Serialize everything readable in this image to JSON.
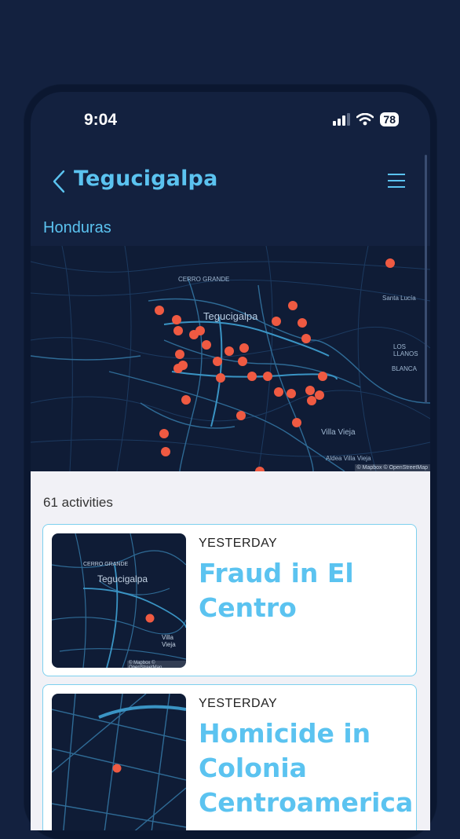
{
  "status_bar": {
    "time": "9:04",
    "battery": "78"
  },
  "header": {
    "title": "Tegucigalpa",
    "subtitle": "Honduras"
  },
  "map": {
    "labels": {
      "city": "Tegucigalpa",
      "cerro_grande": "CERRO GRANDE",
      "villa_vieja": "Villa Vieja",
      "aldea_villa_vieja": "Aldea Villa Vieja",
      "santa_lucia": "Santa Lucía",
      "los_llanos": "LOS LLANOS",
      "blanca": "BLANCA"
    },
    "attribution": "© Mapbox © OpenStreetMap"
  },
  "activities": {
    "count_label": "61 activities",
    "items": [
      {
        "when": "YESTERDAY",
        "title": "Fraud in El Centro",
        "thumb_city": "Tegucigalpa",
        "thumb_area": "CERRO GRANDE",
        "thumb_villa": "Villa Vieja",
        "thumb_attrib": "© Mapbox © OpenStreetMap"
      },
      {
        "when": "YESTERDAY",
        "title": "Homicide in Colonia Centroamerica"
      }
    ]
  },
  "colors": {
    "accent": "#5bc3f0",
    "marker": "#ef5a42",
    "background": "#13213f"
  },
  "icons": [
    "back-chevron-icon",
    "menu-icon",
    "signal-icon",
    "wifi-icon",
    "battery-icon"
  ]
}
